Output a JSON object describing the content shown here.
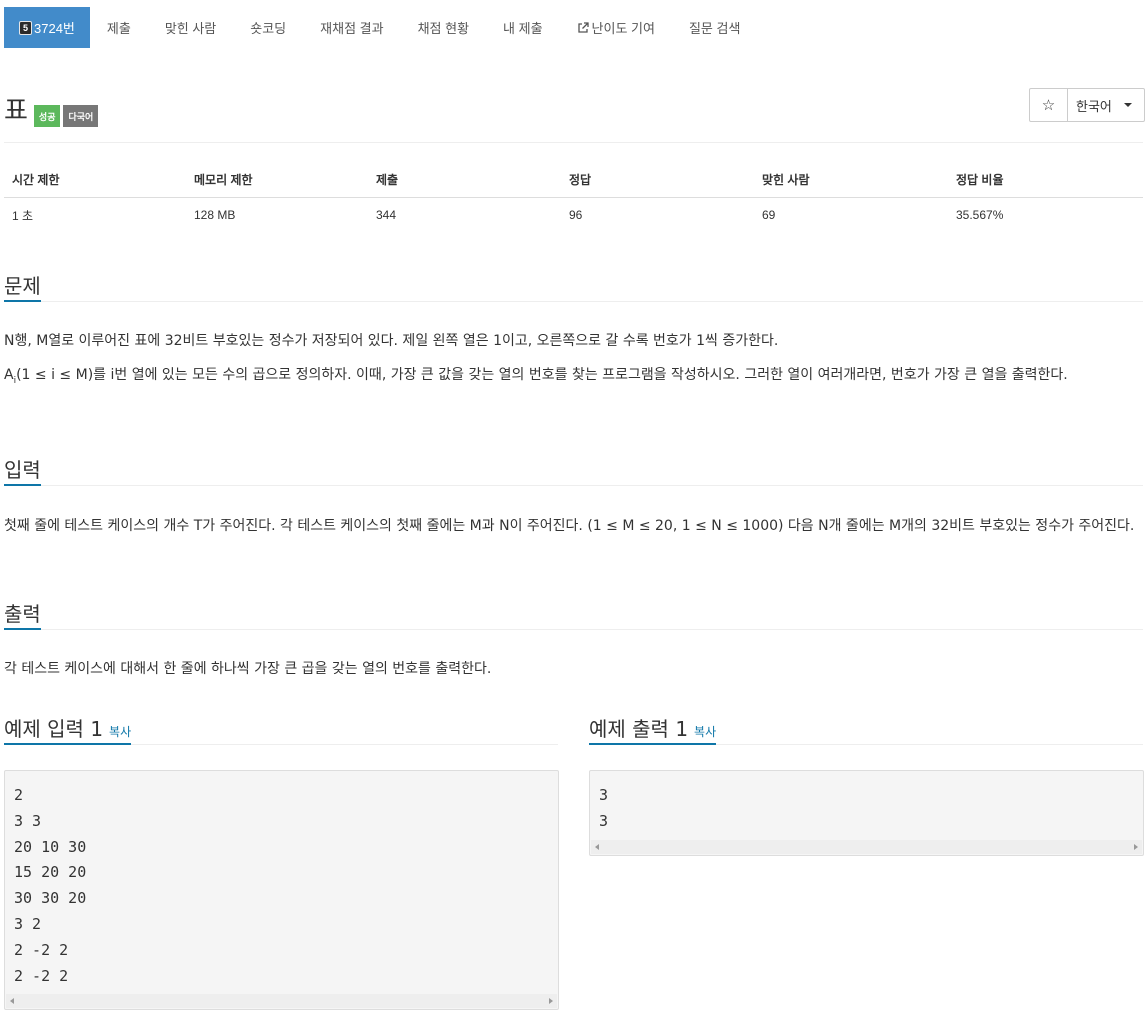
{
  "nav": {
    "problem_number": "3724번",
    "tier_label": "5",
    "tabs": [
      "제출",
      "맞힌 사람",
      "숏코딩",
      "재채점 결과",
      "채점 현황",
      "내 제출",
      "난이도 기여",
      "질문 검색"
    ]
  },
  "title": "표",
  "labels": {
    "success": "성공",
    "multilang": "다국어"
  },
  "star": "☆",
  "language": "한국어",
  "stats": {
    "headers": [
      "시간 제한",
      "메모리 제한",
      "제출",
      "정답",
      "맞힌 사람",
      "정답 비율"
    ],
    "values": [
      "1 초",
      "128 MB",
      "344",
      "96",
      "69",
      "35.567%"
    ]
  },
  "sections": {
    "problem": "문제",
    "input": "입력",
    "output": "출력",
    "sample_input": "예제 입력 1",
    "sample_output": "예제 출력 1",
    "copy": "복사"
  },
  "problem_text": {
    "p1": "N행, M열로 이루어진 표에 32비트 부호있는 정수가 저장되어 있다. 제일 왼쪽 열은 1이고, 오른쪽으로 갈 수록 번호가 1씩 증가한다.",
    "p2_a": "A",
    "p2_sub": "i",
    "p2_b": "(1 ≤ i ≤ M)를 i번 열에 있는 모든 수의 곱으로 정의하자. 이때, 가장 큰 값을 갖는 열의 번호를 찾는 프로그램을 작성하시오. 그러한 열이 여러개라면, 번호가 가장 큰 열을 출력한다."
  },
  "input_text": "첫째 줄에 테스트 케이스의 개수 T가 주어진다. 각 테스트 케이스의 첫째 줄에는 M과 N이 주어진다. (1 ≤ M ≤ 20, 1 ≤ N ≤ 1000) 다음 N개 줄에는 M개의 32비트 부호있는 정수가 주어진다.",
  "output_text": "각 테스트 케이스에 대해서 한 줄에 하나씩 가장 큰 곱을 갖는 열의 번호를 출력한다.",
  "sample_input": "2\n3 3\n20 10 30\n15 20 20\n30 30 20\n3 2\n2 -2 2\n2 -2 2",
  "sample_output": "3\n3"
}
